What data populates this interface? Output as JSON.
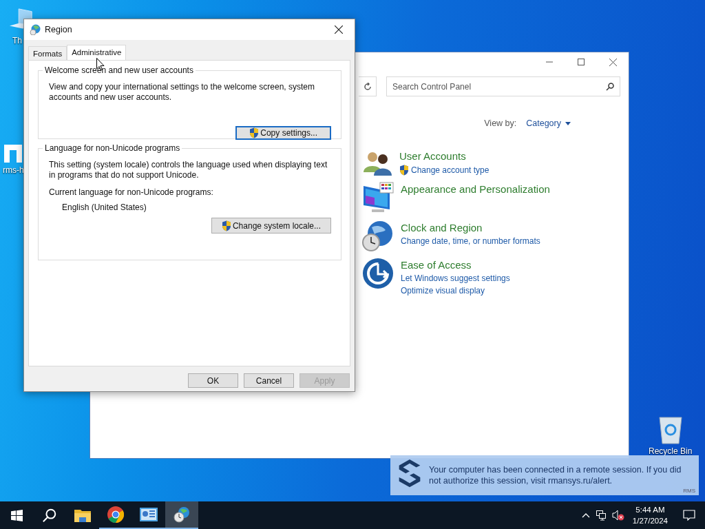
{
  "desktop_icons": [
    {
      "label": "Th"
    },
    {
      "label": "rms-h"
    },
    {
      "label": "Recycle Bin"
    }
  ],
  "control_panel": {
    "search": {
      "placeholder": "Search Control Panel"
    },
    "view_by": {
      "label": "View by:",
      "value": "Category"
    },
    "categories": [
      {
        "kind": "users",
        "title": "User Accounts",
        "links": [
          {
            "text": "Change account type",
            "shield": true
          }
        ]
      },
      {
        "kind": "appearance",
        "title": "Appearance and Personalization"
      },
      {
        "kind": "clock",
        "title": "Clock and Region",
        "links": [
          {
            "text": "Change date, time, or number formats",
            "shield": false
          }
        ]
      },
      {
        "kind": "access",
        "title": "Ease of Access",
        "links": [
          {
            "text": "Let Windows suggest settings",
            "shield": false
          },
          {
            "text": "Optimize visual display",
            "shield": false
          }
        ]
      }
    ]
  },
  "region_dialog": {
    "title": "Region",
    "tabs": [
      {
        "label": "Formats",
        "selected": false
      },
      {
        "label": "Administrative",
        "selected": true
      }
    ],
    "groups": [
      {
        "title": "Welcome screen and new user accounts",
        "description": "View and copy your international settings to the welcome screen, system accounts and new user accounts.",
        "button": {
          "label": "Copy settings...",
          "default": true
        }
      },
      {
        "title": "Language for non-Unicode programs",
        "description": "This setting (system locale) controls the language used when displaying text in programs that do not support Unicode.",
        "current_label": "Current language for non-Unicode programs:",
        "current_value": "English (United States)",
        "button": {
          "label": "Change system locale...",
          "default": false
        }
      }
    ],
    "buttons": [
      {
        "label": "OK",
        "disabled": false
      },
      {
        "label": "Cancel",
        "disabled": false
      },
      {
        "label": "Apply",
        "disabled": true
      }
    ]
  },
  "notification": {
    "message": "Your computer has been connected in a remote session. If you did not authorize this session, visit rmansys.ru/alert.",
    "source": "RMS"
  },
  "taskbar": {
    "apps": [
      {
        "kind": "start",
        "running": false,
        "active": false
      },
      {
        "kind": "search",
        "running": false,
        "active": false
      },
      {
        "kind": "explorer",
        "running": false,
        "active": false
      },
      {
        "kind": "chrome",
        "running": true,
        "active": false
      },
      {
        "kind": "control",
        "running": true,
        "active": false
      },
      {
        "kind": "region",
        "running": true,
        "active": true
      }
    ],
    "time": "5:44 AM",
    "date": "1/27/2024"
  }
}
